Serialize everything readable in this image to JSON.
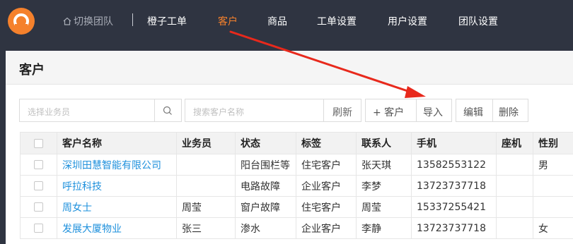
{
  "header": {
    "switch_team": "切换团队",
    "nav": [
      {
        "label": "橙子工单",
        "active": false
      },
      {
        "label": "客户",
        "active": true
      },
      {
        "label": "商品",
        "active": false
      },
      {
        "label": "工单设置",
        "active": false
      },
      {
        "label": "用户设置",
        "active": false
      },
      {
        "label": "团队设置",
        "active": false
      }
    ]
  },
  "page": {
    "title": "客户"
  },
  "toolbar": {
    "salesperson_placeholder": "选择业务员",
    "customer_placeholder": "搜索客户名称",
    "refresh_label": "刷新",
    "add_label": "+ 客户",
    "import_label": "导入",
    "edit_label": "编辑",
    "delete_label": "删除"
  },
  "table": {
    "columns": [
      "客户名称",
      "业务员",
      "状态",
      "标签",
      "联系人",
      "手机",
      "座机",
      "性别"
    ],
    "rows": [
      {
        "name": "深圳田慧智能有限公司",
        "salesperson": "",
        "status": "阳台围栏等",
        "tag": "住宅客户",
        "contact": "张天琪",
        "mobile": "13582553122",
        "phone": "",
        "gender": "男"
      },
      {
        "name": "呼拉科技",
        "salesperson": "",
        "status": "电路故障",
        "tag": "企业客户",
        "contact": "李梦",
        "mobile": "13723737718",
        "phone": "",
        "gender": ""
      },
      {
        "name": "周女士",
        "salesperson": "周莹",
        "status": "窗户故障",
        "tag": "住宅客户",
        "contact": "周莹",
        "mobile": "15337255421",
        "phone": "",
        "gender": ""
      },
      {
        "name": "发展大厦物业",
        "salesperson": "张三",
        "status": "渗水",
        "tag": "企业客户",
        "contact": "李静",
        "mobile": "13723737718",
        "phone": "",
        "gender": "女"
      }
    ]
  },
  "colors": {
    "topbar": "#2f3441",
    "accent": "#f5812c",
    "link": "#1e90dc",
    "arrow": "#e8291c"
  }
}
